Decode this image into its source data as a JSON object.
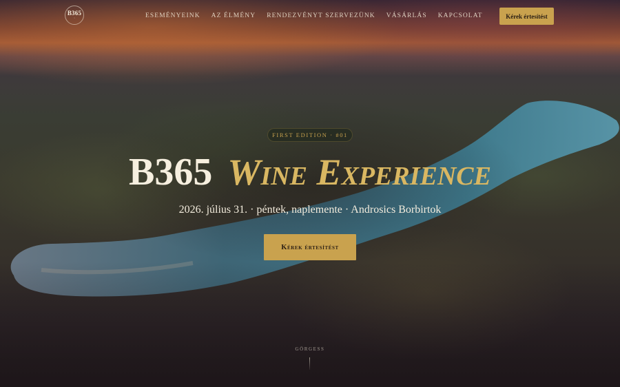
{
  "nav": {
    "logo_text": "B365",
    "items": [
      {
        "label": "Eseményeink"
      },
      {
        "label": "Az élmény"
      },
      {
        "label": "Rendezvényt szervezünk"
      },
      {
        "label": "Vásárlás"
      },
      {
        "label": "Kapcsolat"
      }
    ],
    "notify_button": "Kérek értesítést"
  },
  "hero": {
    "badge": "FIRST EDITION · #01",
    "title_main": "B365",
    "title_accent": "Wine Experience",
    "subtitle": "2026. július 31. · péntek, naplemente · Androsics Borbirtok",
    "cta": "Kérek értesítést",
    "scroll_hint": "GÖRGESS"
  },
  "colors": {
    "accent_gold": "#c9a24e",
    "title_gold": "#d9b762",
    "text_cream": "#f2ead8"
  }
}
